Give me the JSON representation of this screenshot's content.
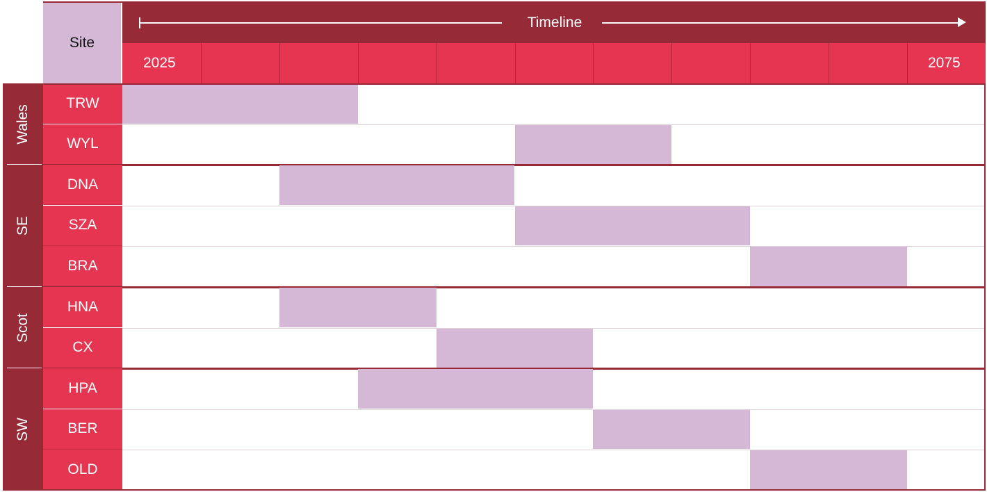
{
  "chart_data": {
    "type": "gantt",
    "header": {
      "site_label": "Site",
      "timeline_label": "Timeline"
    },
    "x_axis": {
      "start": 2025,
      "end": 2075,
      "step": 5,
      "tick_labels": [
        "2025",
        "",
        "",
        "",
        "",
        "",
        "",
        "",
        "",
        "",
        "2075"
      ]
    },
    "groups": [
      {
        "region": "Wales",
        "sites": [
          {
            "site": "TRW",
            "start": 2025,
            "end": 2040
          },
          {
            "site": "WYL",
            "start": 2050,
            "end": 2060
          }
        ]
      },
      {
        "region": "SE",
        "sites": [
          {
            "site": "DNA",
            "start": 2035,
            "end": 2050
          },
          {
            "site": "SZA",
            "start": 2050,
            "end": 2065
          },
          {
            "site": "BRA",
            "start": 2065,
            "end": 2075
          }
        ]
      },
      {
        "region": "Scot",
        "sites": [
          {
            "site": "HNA",
            "start": 2035,
            "end": 2045
          },
          {
            "site": "CX",
            "start": 2045,
            "end": 2055
          }
        ]
      },
      {
        "region": "SW",
        "sites": [
          {
            "site": "HPA",
            "start": 2040,
            "end": 2055
          },
          {
            "site": "BER",
            "start": 2055,
            "end": 2065
          },
          {
            "site": "OLD",
            "start": 2065,
            "end": 2075
          }
        ]
      }
    ],
    "colors": {
      "bar": "#d4b8d6",
      "header_dark": "#962b37",
      "header_red": "#e63550"
    }
  }
}
